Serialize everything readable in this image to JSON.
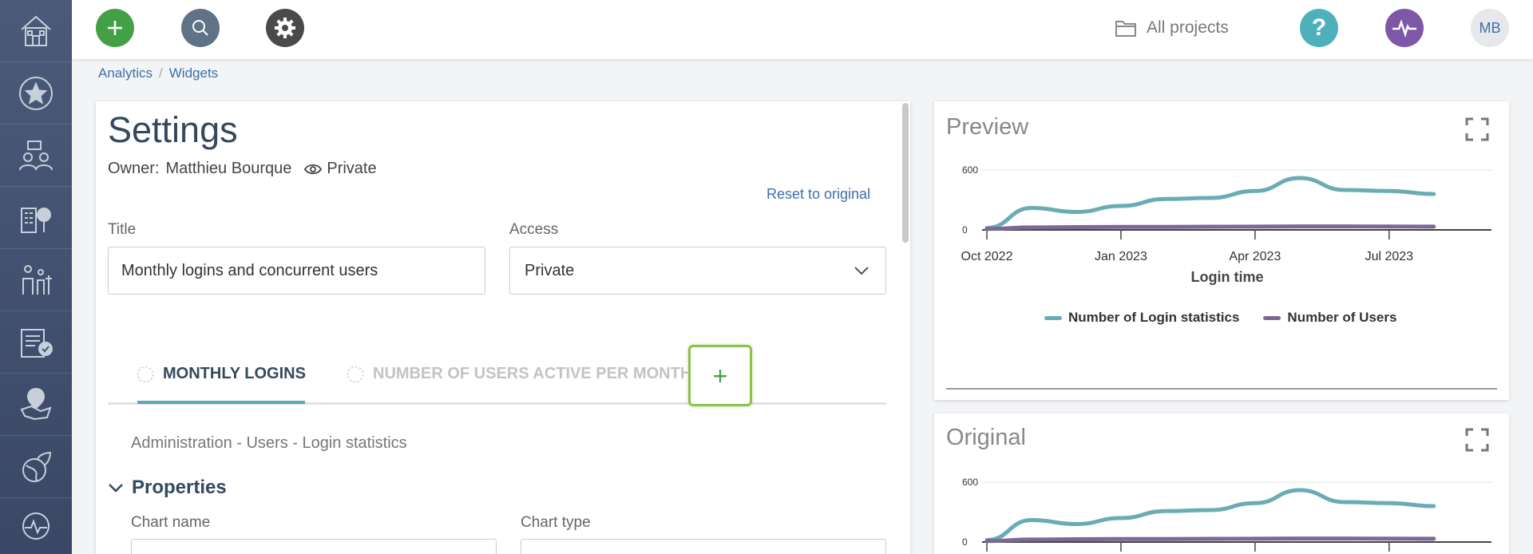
{
  "topbar": {
    "projects_label": "All projects",
    "help_label": "?",
    "avatar_initials": "MB"
  },
  "breadcrumb": {
    "items": [
      "Analytics",
      "Widgets"
    ],
    "separator": "/"
  },
  "settings": {
    "title": "Settings",
    "owner_label": "Owner:",
    "owner_name": "Matthieu Bourque",
    "visibility": "Private",
    "reset_label": "Reset to original",
    "title_label": "Title",
    "title_value": "Monthly logins and concurrent users",
    "access_label": "Access",
    "access_value": "Private",
    "tabs": [
      {
        "label": "MONTHLY LOGINS",
        "active": true
      },
      {
        "label": "NUMBER OF USERS ACTIVE PER MONTH",
        "active": false
      }
    ],
    "add_tab_symbol": "+",
    "source_path": "Administration - Users - Login statistics",
    "properties_label": "Properties",
    "chart_name_label": "Chart name",
    "chart_type_label": "Chart type"
  },
  "preview": {
    "title": "Preview"
  },
  "original": {
    "title": "Original"
  },
  "colors": {
    "sidebar": "#45556f",
    "green_accent": "#43a047",
    "teal": "#6aacb5",
    "purple": "#7c6897",
    "link": "#3f6fa8",
    "highlight": "#8bc34a"
  },
  "chart_data": {
    "type": "line",
    "xlabel": "Login time",
    "ylabel": "",
    "x_tick_labels": [
      "Oct 2022",
      "Jan 2023",
      "Apr 2023",
      "Jul 2023"
    ],
    "y_tick_labels": [
      "0",
      "600"
    ],
    "ylim": [
      0,
      600
    ],
    "x": [
      "Oct 2022",
      "Nov 2022",
      "Dec 2022",
      "Jan 2023",
      "Feb 2023",
      "Mar 2023",
      "Apr 2023",
      "May 2023",
      "Jun 2023",
      "Jul 2023",
      "Aug 2023"
    ],
    "series": [
      {
        "name": "Number of Login statistics",
        "color": "#6aacb5",
        "values": [
          20,
          220,
          180,
          240,
          310,
          320,
          390,
          520,
          400,
          390,
          360
        ]
      },
      {
        "name": "Number of Users",
        "color": "#7c6897",
        "values": [
          10,
          25,
          28,
          30,
          30,
          32,
          33,
          35,
          35,
          34,
          33
        ]
      }
    ],
    "grid": true,
    "legend_position": "bottom"
  }
}
